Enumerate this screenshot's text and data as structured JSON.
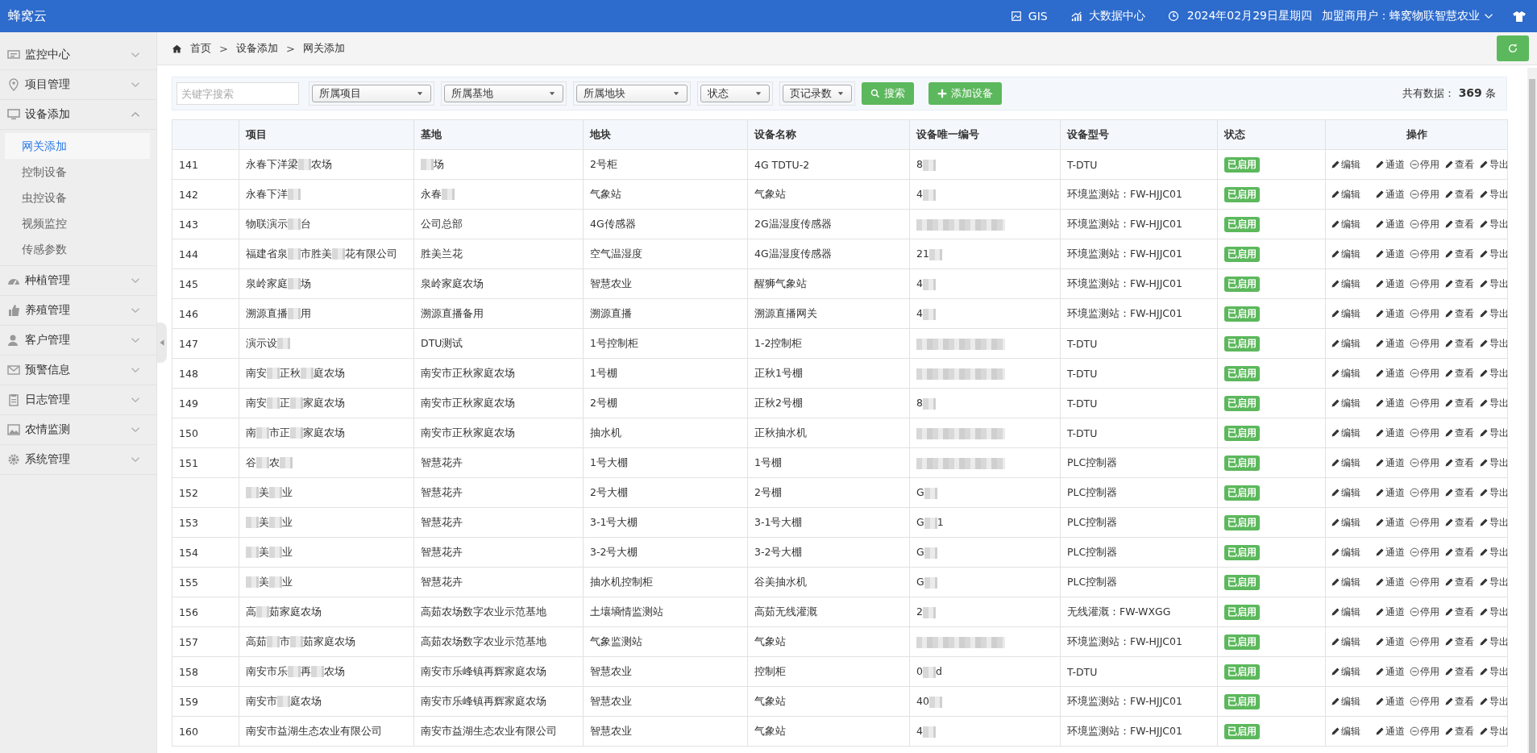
{
  "header": {
    "logo": "蜂窝云",
    "links": [
      {
        "kind": "map",
        "label": "GIS"
      },
      {
        "kind": "chart",
        "label": "大数据中心"
      }
    ],
    "date": "2024年02月29日星期四",
    "user": "加盟商用户：蜂窝物联智慧农业"
  },
  "sidebar": {
    "items": [
      {
        "label": "监控中心",
        "expanded": false
      },
      {
        "label": "项目管理",
        "expanded": false
      },
      {
        "label": "设备添加",
        "expanded": true,
        "children": [
          {
            "label": "网关添加",
            "selected": true
          },
          {
            "label": "控制设备",
            "selected": false
          },
          {
            "label": "虫控设备",
            "selected": false
          },
          {
            "label": "视频监控",
            "selected": false
          },
          {
            "label": "传感参数",
            "selected": false
          }
        ]
      },
      {
        "label": "种植管理",
        "expanded": false
      },
      {
        "label": "养殖管理",
        "expanded": false
      },
      {
        "label": "客户管理",
        "expanded": false
      },
      {
        "label": "预警信息",
        "expanded": false
      },
      {
        "label": "日志管理",
        "expanded": false
      },
      {
        "label": "农情监测",
        "expanded": false
      },
      {
        "label": "系统管理",
        "expanded": false
      }
    ]
  },
  "breadcrumb": [
    {
      "kind": "link",
      "text": "首页"
    },
    {
      "kind": "separator",
      "text": ">"
    },
    {
      "kind": "link",
      "text": "设备添加"
    },
    {
      "kind": "separator",
      "text": ">"
    },
    {
      "kind": "link",
      "text": "网关添加"
    }
  ],
  "toolbar": {
    "search": {
      "placeholder": "关键字搜索"
    },
    "selects": [
      "所属项目",
      "所属基地",
      "所属地块",
      "状态",
      "页记录数"
    ],
    "search_button": "搜索",
    "add_button": "添加设备",
    "total": {
      "label": "共有数据：",
      "count": "369",
      "unit": "条"
    }
  },
  "table": {
    "columns": [
      "",
      "项目",
      "基地",
      "地块",
      "设备名称",
      "设备唯一编号",
      "设备型号",
      "状态",
      "操作"
    ],
    "rows": [
      {
        "cells": [
          "141",
          [
            {
              "kind": "text",
              "text": "永春下洋梁"
            },
            {
              "kind": "blur"
            },
            {
              "kind": "text",
              "text": "农场"
            }
          ],
          [
            {
              "kind": "blur"
            },
            {
              "kind": "text",
              "text": "场"
            }
          ],
          "2号柜",
          "4G TDTU-2",
          [
            {
              "kind": "text",
              "text": "8"
            },
            {
              "kind": "blur"
            }
          ],
          "T-DTU"
        ],
        "status": "已启用",
        "actions": [
          {
            "kind": "link",
            "label": "编辑"
          },
          {
            "kind": "link",
            "label": "通道"
          },
          {
            "kind": "toggle",
            "label": "停用"
          },
          {
            "kind": "link",
            "label": "查看"
          },
          {
            "kind": "link",
            "label": "导出"
          }
        ]
      },
      {
        "cells": [
          "142",
          [
            {
              "kind": "text",
              "text": "永春下洋"
            },
            {
              "kind": "blur"
            }
          ],
          [
            {
              "kind": "text",
              "text": "永春"
            },
            {
              "kind": "blur"
            }
          ],
          "气象站",
          "气象站",
          [
            {
              "kind": "text",
              "text": "4"
            },
            {
              "kind": "blur"
            }
          ],
          "环境监测站：FW-HJJC01"
        ],
        "status": "已启用",
        "actions": [
          {
            "kind": "link",
            "label": "编辑"
          },
          {
            "kind": "link",
            "label": "通道"
          },
          {
            "kind": "toggle",
            "label": "停用"
          },
          {
            "kind": "link",
            "label": "查看"
          },
          {
            "kind": "link",
            "label": "导出"
          }
        ]
      },
      {
        "cells": [
          "143",
          [
            {
              "kind": "text",
              "text": "物联演示"
            },
            {
              "kind": "blur"
            },
            {
              "kind": "text",
              "text": "台"
            }
          ],
          "公司总部",
          "4G传感器",
          "2G温湿度传感器",
          [
            {
              "kind": "blur"
            }
          ],
          "环境监测站：FW-HJJC01"
        ],
        "status": "已启用",
        "actions": [
          {
            "kind": "link",
            "label": "编辑"
          },
          {
            "kind": "link",
            "label": "通道"
          },
          {
            "kind": "toggle",
            "label": "停用"
          },
          {
            "kind": "link",
            "label": "查看"
          },
          {
            "kind": "link",
            "label": "导出"
          }
        ]
      },
      {
        "cells": [
          "144",
          [
            {
              "kind": "text",
              "text": "福建省泉"
            },
            {
              "kind": "blur"
            },
            {
              "kind": "text",
              "text": "市胜美"
            },
            {
              "kind": "blur"
            },
            {
              "kind": "text",
              "text": "花有限公司"
            }
          ],
          "胜美兰花",
          "空气温湿度",
          "4G温湿度传感器",
          [
            {
              "kind": "text",
              "text": "21"
            },
            {
              "kind": "blur"
            }
          ],
          "环境监测站：FW-HJJC01"
        ],
        "status": "已启用",
        "actions": [
          {
            "kind": "link",
            "label": "编辑"
          },
          {
            "kind": "link",
            "label": "通道"
          },
          {
            "kind": "toggle",
            "label": "停用"
          },
          {
            "kind": "link",
            "label": "查看"
          },
          {
            "kind": "link",
            "label": "导出"
          }
        ]
      },
      {
        "cells": [
          "145",
          [
            {
              "kind": "text",
              "text": "泉岭家庭"
            },
            {
              "kind": "blur"
            },
            {
              "kind": "text",
              "text": "场"
            }
          ],
          "泉岭家庭农场",
          "智慧农业",
          "醒狮气象站",
          [
            {
              "kind": "text",
              "text": "4"
            },
            {
              "kind": "blur"
            }
          ],
          "环境监测站：FW-HJJC01"
        ],
        "status": "已启用",
        "actions": [
          {
            "kind": "link",
            "label": "编辑"
          },
          {
            "kind": "link",
            "label": "通道"
          },
          {
            "kind": "toggle",
            "label": "停用"
          },
          {
            "kind": "link",
            "label": "查看"
          },
          {
            "kind": "link",
            "label": "导出"
          }
        ]
      },
      {
        "cells": [
          "146",
          [
            {
              "kind": "text",
              "text": "溯源直播"
            },
            {
              "kind": "blur"
            },
            {
              "kind": "text",
              "text": "用"
            }
          ],
          "溯源直播备用",
          "溯源直播",
          "溯源直播网关",
          [
            {
              "kind": "text",
              "text": "4"
            },
            {
              "kind": "blur"
            }
          ],
          "环境监测站：FW-HJJC01"
        ],
        "status": "已启用",
        "actions": [
          {
            "kind": "link",
            "label": "编辑"
          },
          {
            "kind": "link",
            "label": "通道"
          },
          {
            "kind": "toggle",
            "label": "停用"
          },
          {
            "kind": "link",
            "label": "查看"
          },
          {
            "kind": "link",
            "label": "导出"
          }
        ]
      },
      {
        "cells": [
          "147",
          [
            {
              "kind": "text",
              "text": "演示设"
            },
            {
              "kind": "blur"
            }
          ],
          "DTU测试",
          "1号控制柜",
          "1-2控制柜",
          [
            {
              "kind": "blur"
            }
          ],
          "T-DTU"
        ],
        "status": "已启用",
        "actions": [
          {
            "kind": "link",
            "label": "编辑"
          },
          {
            "kind": "link",
            "label": "通道"
          },
          {
            "kind": "toggle",
            "label": "停用"
          },
          {
            "kind": "link",
            "label": "查看"
          },
          {
            "kind": "link",
            "label": "导出"
          }
        ]
      },
      {
        "cells": [
          "148",
          [
            {
              "kind": "text",
              "text": "南安"
            },
            {
              "kind": "blur"
            },
            {
              "kind": "text",
              "text": "正秋"
            },
            {
              "kind": "blur"
            },
            {
              "kind": "text",
              "text": "庭农场"
            }
          ],
          "南安市正秋家庭农场",
          "1号棚",
          "正秋1号棚",
          [
            {
              "kind": "blur"
            }
          ],
          "T-DTU"
        ],
        "status": "已启用",
        "actions": [
          {
            "kind": "link",
            "label": "编辑"
          },
          {
            "kind": "link",
            "label": "通道"
          },
          {
            "kind": "toggle",
            "label": "停用"
          },
          {
            "kind": "link",
            "label": "查看"
          },
          {
            "kind": "link",
            "label": "导出"
          }
        ]
      },
      {
        "cells": [
          "149",
          [
            {
              "kind": "text",
              "text": "南安"
            },
            {
              "kind": "blur"
            },
            {
              "kind": "text",
              "text": "正"
            },
            {
              "kind": "blur"
            },
            {
              "kind": "text",
              "text": "家庭农场"
            }
          ],
          "南安市正秋家庭农场",
          "2号棚",
          "正秋2号棚",
          [
            {
              "kind": "text",
              "text": "8"
            },
            {
              "kind": "blur"
            }
          ],
          "T-DTU"
        ],
        "status": "已启用",
        "actions": [
          {
            "kind": "link",
            "label": "编辑"
          },
          {
            "kind": "link",
            "label": "通道"
          },
          {
            "kind": "toggle",
            "label": "停用"
          },
          {
            "kind": "link",
            "label": "查看"
          },
          {
            "kind": "link",
            "label": "导出"
          }
        ]
      },
      {
        "cells": [
          "150",
          [
            {
              "kind": "text",
              "text": "南"
            },
            {
              "kind": "blur"
            },
            {
              "kind": "text",
              "text": "市正"
            },
            {
              "kind": "blur"
            },
            {
              "kind": "text",
              "text": "家庭农场"
            }
          ],
          "南安市正秋家庭农场",
          "抽水机",
          "正秋抽水机",
          [
            {
              "kind": "blur"
            }
          ],
          "T-DTU"
        ],
        "status": "已启用",
        "actions": [
          {
            "kind": "link",
            "label": "编辑"
          },
          {
            "kind": "link",
            "label": "通道"
          },
          {
            "kind": "toggle",
            "label": "停用"
          },
          {
            "kind": "link",
            "label": "查看"
          },
          {
            "kind": "link",
            "label": "导出"
          }
        ]
      },
      {
        "cells": [
          "151",
          [
            {
              "kind": "text",
              "text": "谷"
            },
            {
              "kind": "blur"
            },
            {
              "kind": "text",
              "text": "农"
            },
            {
              "kind": "blur"
            }
          ],
          "智慧花卉",
          "1号大棚",
          "1号棚",
          [
            {
              "kind": "blur"
            }
          ],
          "PLC控制器"
        ],
        "status": "已启用",
        "actions": [
          {
            "kind": "link",
            "label": "编辑"
          },
          {
            "kind": "link",
            "label": "通道"
          },
          {
            "kind": "toggle",
            "label": "停用"
          },
          {
            "kind": "link",
            "label": "查看"
          },
          {
            "kind": "link",
            "label": "导出"
          }
        ]
      },
      {
        "cells": [
          "152",
          [
            {
              "kind": "blur"
            },
            {
              "kind": "text",
              "text": "美"
            },
            {
              "kind": "blur"
            },
            {
              "kind": "text",
              "text": "业"
            }
          ],
          "智慧花卉",
          "2号大棚",
          "2号棚",
          [
            {
              "kind": "text",
              "text": "G"
            },
            {
              "kind": "blur"
            }
          ],
          "PLC控制器"
        ],
        "status": "已启用",
        "actions": [
          {
            "kind": "link",
            "label": "编辑"
          },
          {
            "kind": "link",
            "label": "通道"
          },
          {
            "kind": "toggle",
            "label": "停用"
          },
          {
            "kind": "link",
            "label": "查看"
          },
          {
            "kind": "link",
            "label": "导出"
          }
        ]
      },
      {
        "cells": [
          "153",
          [
            {
              "kind": "blur"
            },
            {
              "kind": "text",
              "text": "美"
            },
            {
              "kind": "blur"
            },
            {
              "kind": "text",
              "text": "业"
            }
          ],
          "智慧花卉",
          "3-1号大棚",
          "3-1号大棚",
          [
            {
              "kind": "text",
              "text": "G"
            },
            {
              "kind": "blur"
            },
            {
              "kind": "text",
              "text": "1"
            }
          ],
          "PLC控制器"
        ],
        "status": "已启用",
        "actions": [
          {
            "kind": "link",
            "label": "编辑"
          },
          {
            "kind": "link",
            "label": "通道"
          },
          {
            "kind": "toggle",
            "label": "停用"
          },
          {
            "kind": "link",
            "label": "查看"
          },
          {
            "kind": "link",
            "label": "导出"
          }
        ]
      },
      {
        "cells": [
          "154",
          [
            {
              "kind": "blur"
            },
            {
              "kind": "text",
              "text": "美"
            },
            {
              "kind": "blur"
            },
            {
              "kind": "text",
              "text": "业"
            }
          ],
          "智慧花卉",
          "3-2号大棚",
          "3-2号大棚",
          [
            {
              "kind": "text",
              "text": "G"
            },
            {
              "kind": "blur"
            }
          ],
          "PLC控制器"
        ],
        "status": "已启用",
        "actions": [
          {
            "kind": "link",
            "label": "编辑"
          },
          {
            "kind": "link",
            "label": "通道"
          },
          {
            "kind": "toggle",
            "label": "停用"
          },
          {
            "kind": "link",
            "label": "查看"
          },
          {
            "kind": "link",
            "label": "导出"
          }
        ]
      },
      {
        "cells": [
          "155",
          [
            {
              "kind": "blur"
            },
            {
              "kind": "text",
              "text": "美"
            },
            {
              "kind": "blur"
            },
            {
              "kind": "text",
              "text": "业"
            }
          ],
          "智慧花卉",
          "抽水机控制柜",
          "谷美抽水机",
          [
            {
              "kind": "text",
              "text": "G"
            },
            {
              "kind": "blur"
            }
          ],
          "PLC控制器"
        ],
        "status": "已启用",
        "actions": [
          {
            "kind": "link",
            "label": "编辑"
          },
          {
            "kind": "link",
            "label": "通道"
          },
          {
            "kind": "toggle",
            "label": "停用"
          },
          {
            "kind": "link",
            "label": "查看"
          },
          {
            "kind": "link",
            "label": "导出"
          }
        ]
      },
      {
        "cells": [
          "156",
          [
            {
              "kind": "text",
              "text": "高"
            },
            {
              "kind": "blur"
            },
            {
              "kind": "text",
              "text": "茹家庭农场"
            }
          ],
          "高茹农场数字农业示范基地",
          "土壤墒情监测站",
          "高茹无线灌溉",
          [
            {
              "kind": "text",
              "text": "2"
            },
            {
              "kind": "blur"
            }
          ],
          "无线灌溉：FW-WXGG"
        ],
        "status": "已启用",
        "actions": [
          {
            "kind": "link",
            "label": "编辑"
          },
          {
            "kind": "link",
            "label": "通道"
          },
          {
            "kind": "toggle",
            "label": "停用"
          },
          {
            "kind": "link",
            "label": "查看"
          },
          {
            "kind": "link",
            "label": "导出"
          }
        ]
      },
      {
        "cells": [
          "157",
          [
            {
              "kind": "text",
              "text": "高茹"
            },
            {
              "kind": "blur"
            },
            {
              "kind": "text",
              "text": "市"
            },
            {
              "kind": "blur"
            },
            {
              "kind": "text",
              "text": "茹家庭农场"
            }
          ],
          "高茹农场数字农业示范基地",
          "气象监测站",
          "气象站",
          [
            {
              "kind": "blur"
            }
          ],
          "环境监测站：FW-HJJC01"
        ],
        "status": "已启用",
        "actions": [
          {
            "kind": "link",
            "label": "编辑"
          },
          {
            "kind": "link",
            "label": "通道"
          },
          {
            "kind": "toggle",
            "label": "停用"
          },
          {
            "kind": "link",
            "label": "查看"
          },
          {
            "kind": "link",
            "label": "导出"
          }
        ]
      },
      {
        "cells": [
          "158",
          [
            {
              "kind": "text",
              "text": "南安市乐"
            },
            {
              "kind": "blur"
            },
            {
              "kind": "text",
              "text": "再"
            },
            {
              "kind": "blur"
            },
            {
              "kind": "text",
              "text": "农场"
            }
          ],
          "南安市乐峰镇再辉家庭农场",
          "智慧农业",
          "控制柜",
          [
            {
              "kind": "text",
              "text": "0"
            },
            {
              "kind": "blur"
            },
            {
              "kind": "text",
              "text": "d"
            }
          ],
          "T-DTU"
        ],
        "status": "已启用",
        "actions": [
          {
            "kind": "link",
            "label": "编辑"
          },
          {
            "kind": "link",
            "label": "通道"
          },
          {
            "kind": "toggle",
            "label": "停用"
          },
          {
            "kind": "link",
            "label": "查看"
          },
          {
            "kind": "link",
            "label": "导出"
          }
        ]
      },
      {
        "cells": [
          "159",
          [
            {
              "kind": "text",
              "text": "南安市"
            },
            {
              "kind": "blur"
            },
            {
              "kind": "text",
              "text": "庭农场"
            }
          ],
          "南安市乐峰镇再辉家庭农场",
          "智慧农业",
          "气象站",
          [
            {
              "kind": "text",
              "text": "40"
            },
            {
              "kind": "blur"
            }
          ],
          "环境监测站：FW-HJJC01"
        ],
        "status": "已启用",
        "actions": [
          {
            "kind": "link",
            "label": "编辑"
          },
          {
            "kind": "link",
            "label": "通道"
          },
          {
            "kind": "toggle",
            "label": "停用"
          },
          {
            "kind": "link",
            "label": "查看"
          },
          {
            "kind": "link",
            "label": "导出"
          }
        ]
      },
      {
        "cells": [
          "160",
          "南安市益湖生态农业有限公司",
          "南安市益湖生态农业有限公司",
          "智慧农业",
          "气象站",
          [
            {
              "kind": "text",
              "text": "4"
            },
            {
              "kind": "blur"
            }
          ],
          "环境监测站：FW-HJJC01"
        ],
        "status": "已启用",
        "actions": [
          {
            "kind": "link",
            "label": "编辑"
          },
          {
            "kind": "link",
            "label": "通道"
          },
          {
            "kind": "toggle",
            "label": "停用"
          },
          {
            "kind": "link",
            "label": "查看"
          },
          {
            "kind": "link",
            "label": "导出"
          }
        ]
      }
    ]
  }
}
